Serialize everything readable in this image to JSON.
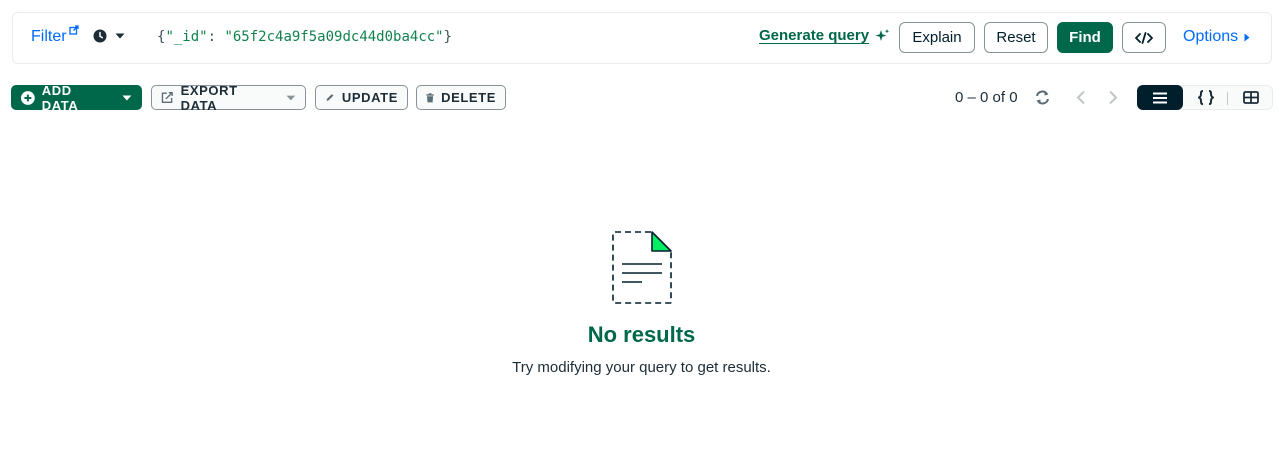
{
  "query_bar": {
    "filter_label": "Filter",
    "query": {
      "open": "{",
      "key": "\"_id\"",
      "colon": ": ",
      "value": "\"65f2c4a9f5a09dc44d0ba4cc\"",
      "close": "}"
    },
    "generate_query_label": "Generate query",
    "explain_label": "Explain",
    "reset_label": "Reset",
    "find_label": "Find",
    "options_label": "Options"
  },
  "toolbar": {
    "add_data_label": "ADD DATA",
    "export_data_label": "EXPORT DATA",
    "update_label": "UPDATE",
    "delete_label": "DELETE",
    "count_text": "0 – 0 of 0"
  },
  "view_toggle": {
    "options": [
      "list",
      "json",
      "table"
    ],
    "active": "list"
  },
  "empty_state": {
    "title": "No results",
    "message": "Try modifying your query to get results."
  },
  "colors": {
    "primary_green": "#00684a",
    "link_blue": "#016bf8",
    "dark": "#001e2b",
    "bright_green": "#00ed64"
  }
}
